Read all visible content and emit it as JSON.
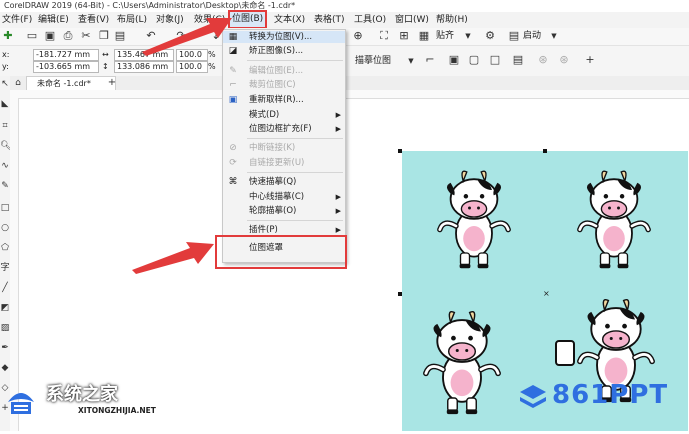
{
  "window": {
    "title": "CorelDRAW 2019 (64-Bit) - C:\\Users\\Administrator\\Desktop\\未命名 -1.cdr*"
  },
  "menubar": {
    "items": [
      "文件(F)",
      "编辑(E)",
      "查看(V)",
      "布局(L)",
      "对象(J)",
      "效果(C)",
      "位图(B)",
      "文本(X)",
      "表格(T)",
      "工具(O)",
      "窗口(W)",
      "帮助(H)"
    ]
  },
  "toolbar": {
    "trace_label": "描摹位图",
    "snap_label": "贴齐",
    "launch_label": "启动"
  },
  "properties": {
    "x": "-181.727 mm",
    "y": "-103.665 mm",
    "width": "135.467 mm",
    "height": "133.086 mm",
    "scale_x": "100.0",
    "scale_y": "100.0",
    "unit": "%"
  },
  "document_tab": {
    "label": "未命名 -1.cdr*"
  },
  "bitmap_menu": {
    "items": [
      {
        "label": "转换为位图(V)...",
        "icon": "convert-bitmap-icon",
        "submenu": false,
        "disabled": false
      },
      {
        "label": "矫正图像(S)...",
        "icon": "straighten-icon",
        "submenu": false,
        "disabled": false
      },
      {
        "label": "编辑位图(E)...",
        "icon": "edit-bitmap-icon",
        "submenu": false,
        "disabled": true
      },
      {
        "label": "裁剪位图(C)",
        "icon": "crop-bitmap-icon",
        "submenu": false,
        "disabled": true
      },
      {
        "label": "重新取样(R)...",
        "icon": "resample-icon",
        "submenu": false,
        "disabled": false
      },
      {
        "label": "模式(D)",
        "icon": "",
        "submenu": true,
        "disabled": false
      },
      {
        "label": "位图边框扩充(F)",
        "icon": "",
        "submenu": true,
        "disabled": false
      },
      {
        "label": "中断链接(K)",
        "icon": "break-link-icon",
        "submenu": false,
        "disabled": true
      },
      {
        "label": "自链接更新(U)",
        "icon": "update-link-icon",
        "submenu": false,
        "disabled": true
      },
      {
        "label": "快速描摹(Q)",
        "icon": "quick-trace-icon",
        "submenu": false,
        "disabled": false
      },
      {
        "label": "中心线描摹(C)",
        "icon": "",
        "submenu": true,
        "disabled": false
      },
      {
        "label": "轮廓描摹(O)",
        "icon": "",
        "submenu": true,
        "disabled": false
      },
      {
        "label": "插件(P)",
        "icon": "",
        "submenu": true,
        "disabled": false
      },
      {
        "label": "位图遮罩",
        "icon": "",
        "submenu": false,
        "disabled": false
      }
    ]
  },
  "watermarks": {
    "left_brand": "系统之家",
    "left_url": "XITONGZHIJIA.NET",
    "right_brand": "861PPT"
  },
  "colors": {
    "accent_red": "#e23b3b",
    "canvas_bg": "#a9e5e4",
    "watermark_blue": "#2f6fe0"
  }
}
